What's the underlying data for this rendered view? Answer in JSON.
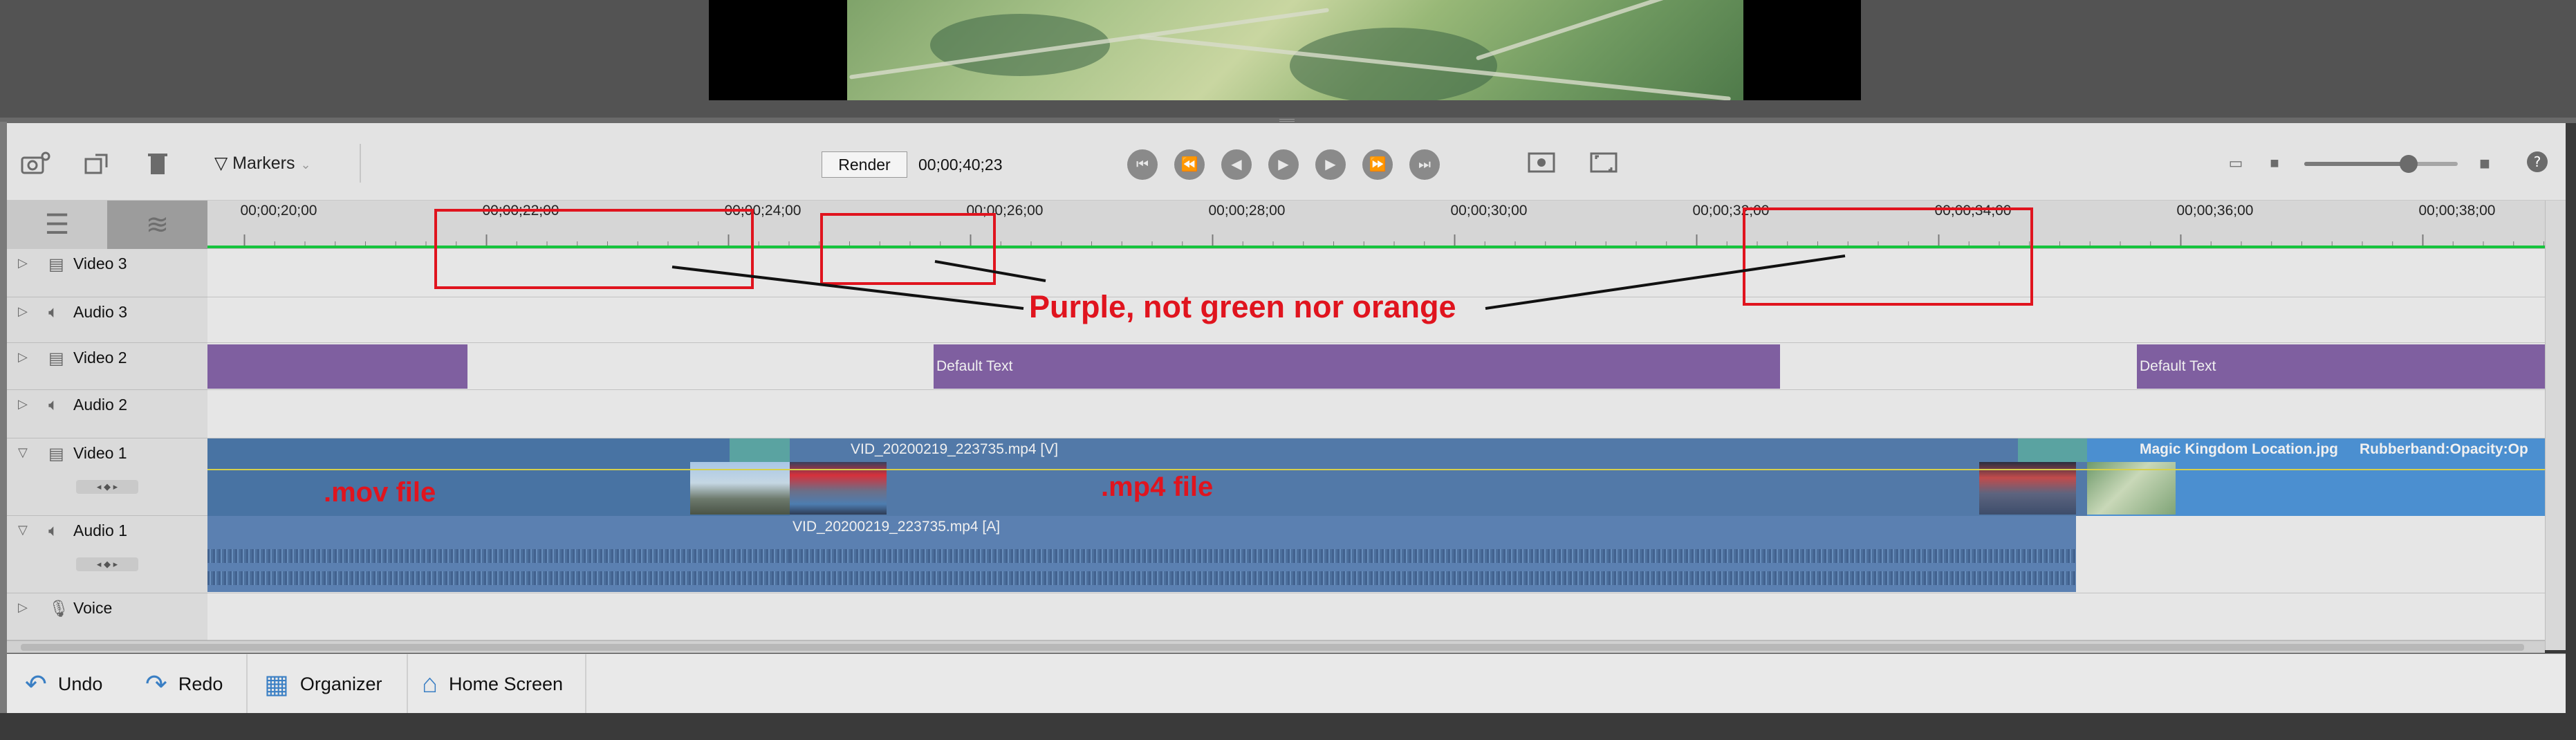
{
  "toolbar": {
    "markers_label": "Markers",
    "render_label": "Render",
    "timecode": "00;00;40;23",
    "zoom_level": 0.68
  },
  "ruler": {
    "ticks": [
      {
        "label": "00;00;20;00",
        "sec": 20
      },
      {
        "label": "00;00;22;00",
        "sec": 22
      },
      {
        "label": "00;00;24;00",
        "sec": 24
      },
      {
        "label": "00;00;26;00",
        "sec": 26
      },
      {
        "label": "00;00;28;00",
        "sec": 28
      },
      {
        "label": "00;00;30;00",
        "sec": 30
      },
      {
        "label": "00;00;32;00",
        "sec": 32
      },
      {
        "label": "00;00;34;00",
        "sec": 34
      },
      {
        "label": "00;00;36;00",
        "sec": 36
      },
      {
        "label": "00;00;38;00",
        "sec": 38
      }
    ]
  },
  "tracks": {
    "video3": "Video 3",
    "audio3": "Audio 3",
    "video2": "Video 2",
    "audio2": "Audio 2",
    "video1": "Video 1",
    "audio1": "Audio 1",
    "voice": "Voice"
  },
  "clips": {
    "text1": "Default Text",
    "text2": "Default Text",
    "video_mp4": "VID_20200219_223735.mp4 [V]",
    "audio_mp4": "VID_20200219_223735.mp4 [A]",
    "image_clip": "Magic Kingdom Location.jpg",
    "image_effect": "Rubberband:Opacity:Op"
  },
  "annotations": {
    "callout": "Purple, not green nor orange",
    "mov_label": ".mov file",
    "mp4_label": ".mp4 file",
    "color": "#e0141e"
  },
  "bottom_bar": {
    "undo": "Undo",
    "redo": "Redo",
    "organizer": "Organizer",
    "home": "Home Screen"
  },
  "colors": {
    "text_clip": "#7f5fa0",
    "video_clip": "#5279a8",
    "ruler_line": "#16c43d"
  }
}
